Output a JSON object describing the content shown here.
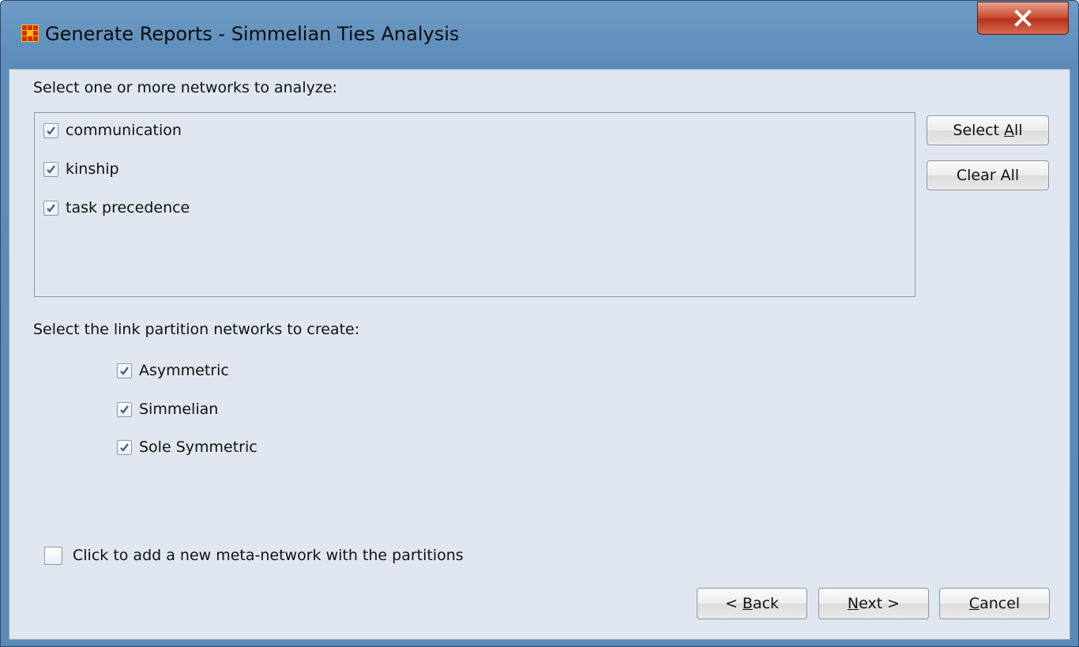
{
  "window": {
    "title": "Generate Reports - Simmelian Ties Analysis",
    "close_icon": "close-x-icon",
    "app_icon": "network-grid-icon"
  },
  "networks": {
    "prompt": "Select one or more networks to analyze:",
    "items": [
      {
        "label": "communication",
        "checked": true
      },
      {
        "label": "kinship",
        "checked": true
      },
      {
        "label": "task precedence",
        "checked": true
      }
    ],
    "select_all": {
      "before": "Select ",
      "mnemonic": "A",
      "after": "ll"
    },
    "clear_all": "Clear All"
  },
  "partitions": {
    "prompt": "Select the link partition networks to create:",
    "items": [
      {
        "label": "Asymmetric",
        "checked": true
      },
      {
        "label": "Simmelian",
        "checked": true
      },
      {
        "label": "Sole Symmetric",
        "checked": true
      }
    ]
  },
  "meta_network": {
    "label": "Click to add a new meta-network with the partitions",
    "checked": false
  },
  "footer": {
    "back": {
      "before": "< ",
      "mnemonic": "B",
      "after": "ack"
    },
    "next": {
      "before": "",
      "mnemonic": "N",
      "after": "ext >"
    },
    "cancel": {
      "before": "",
      "mnemonic": "C",
      "after": "ancel"
    }
  },
  "colors": {
    "checkmark": "#3c5f91",
    "close_button": "#c7452b",
    "panel": "#dfe6ef"
  }
}
